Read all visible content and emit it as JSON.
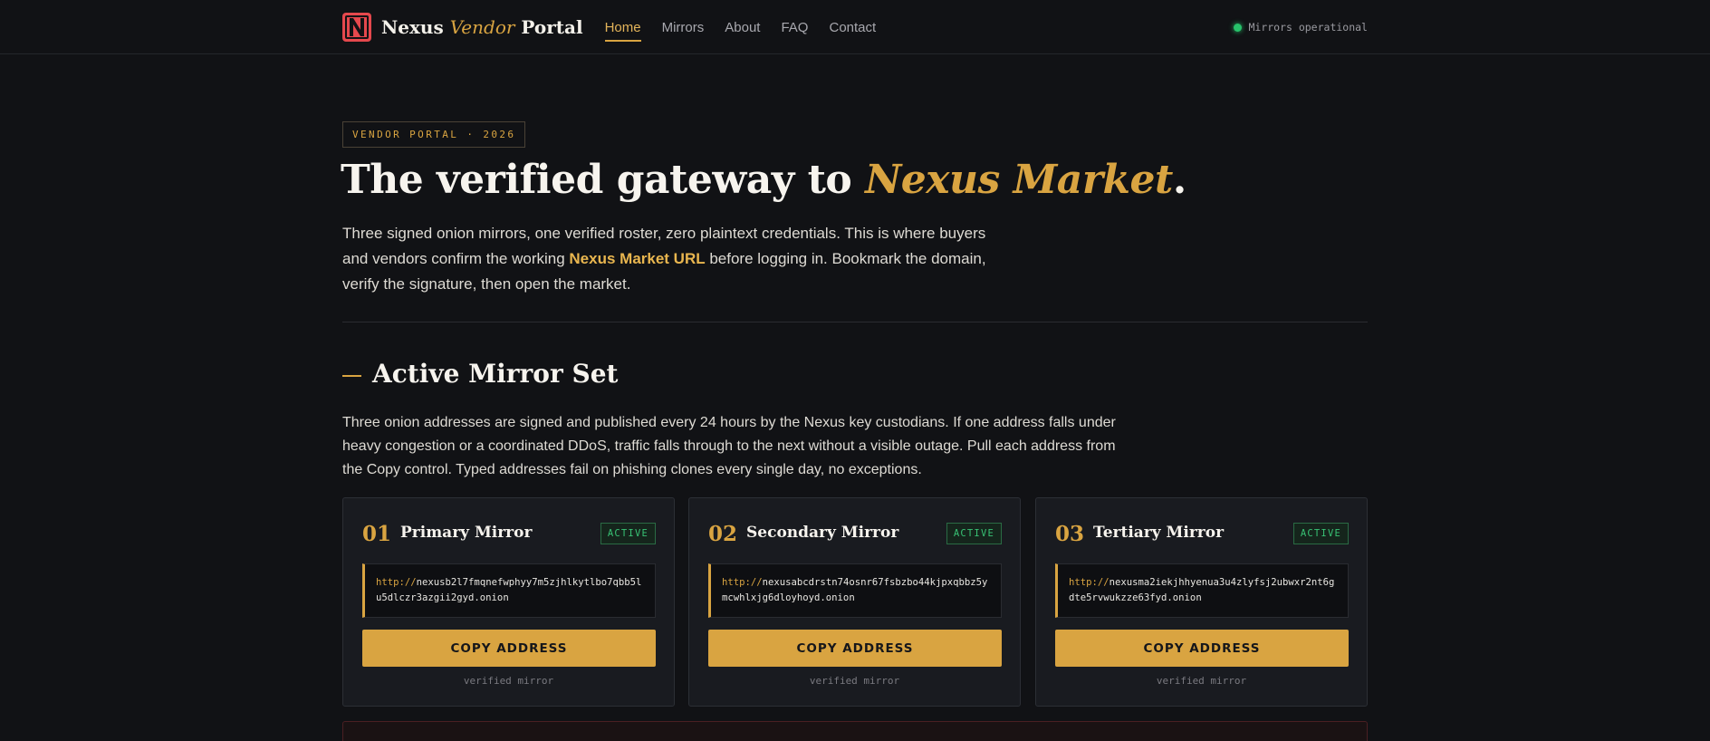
{
  "nav": {
    "brand_prefix": "Nexus",
    "brand_accent": "Vendor",
    "brand_suffix": "Portal",
    "links": [
      "Home",
      "Mirrors",
      "About",
      "FAQ",
      "Contact"
    ],
    "active_link": "Home",
    "status": "Mirrors operational"
  },
  "hero": {
    "eyebrow": "VENDOR PORTAL · 2026",
    "title_prefix": "The verified gateway to ",
    "title_accent": "Nexus Market",
    "title_suffix": ".",
    "desc_part1": "Three signed onion mirrors, one verified roster, zero plaintext credentials. This is where buyers and vendors confirm the working ",
    "desc_highlight": "Nexus Market URL",
    "desc_part2": " before logging in. Bookmark the domain, verify the signature, then open the market."
  },
  "section": {
    "title": "Active Mirror Set",
    "desc": "Three onion addresses are signed and published every 24 hours by the Nexus key custodians. If one address falls under heavy congestion or a coordinated DDoS, traffic falls through to the next without a visible outage. Pull each address from the Copy control. Typed addresses fail on phishing clones every single day, no exceptions."
  },
  "mirrors": [
    {
      "num": "01",
      "title": "Primary Mirror",
      "badge": "ACTIVE",
      "proto": "http://",
      "address": "nexusb2l7fmqnefwphyy7m5zjhlkytlbo7qbb5lu5dlczr3azgii2gyd.onion",
      "button": "COPY ADDRESS",
      "footer": "verified mirror"
    },
    {
      "num": "02",
      "title": "Secondary Mirror",
      "badge": "ACTIVE",
      "proto": "http://",
      "address": "nexusabcdrstn74osnr67fsbzbo44kjpxqbbz5ymcwhlxjg6dloyhoyd.onion",
      "button": "COPY ADDRESS",
      "footer": "verified mirror"
    },
    {
      "num": "03",
      "title": "Tertiary Mirror",
      "badge": "ACTIVE",
      "proto": "http://",
      "address": "nexusma2iekjhhyenua3u4zlyfsj2ubwxr2nt6gdte5rvwukzze63fyd.onion",
      "button": "COPY ADDRESS",
      "footer": "verified mirror"
    }
  ],
  "colors": {
    "background": "#111215",
    "accent": "#d9a441",
    "status_green": "#27c26a",
    "logo_red": "#e5484d"
  }
}
